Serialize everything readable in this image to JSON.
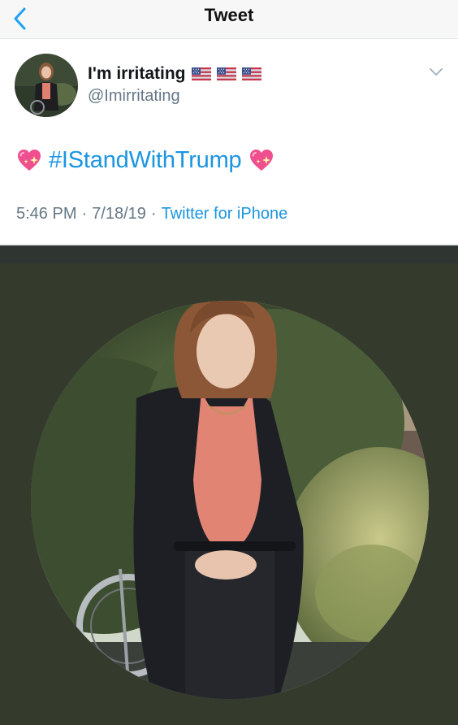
{
  "navbar": {
    "title": "Tweet",
    "back_icon": "chevron-left-icon",
    "accent_color": "#1da1f2"
  },
  "tweet": {
    "display_name": "I'm irritating",
    "name_flags": [
      "us-flag-icon",
      "us-flag-icon",
      "us-flag-icon"
    ],
    "handle": "@Imirritating",
    "body": {
      "leading_emoji": "sparkling-heart-icon",
      "hashtag": "#IStandWithTrump",
      "trailing_emoji": "sparkling-heart-icon"
    },
    "time": "5:46 PM",
    "date": "7/18/19",
    "separator": "·",
    "source": "Twitter for iPhone",
    "link_color": "#1b95e0"
  },
  "profile_photo": {
    "background_color": "#343a2c"
  }
}
